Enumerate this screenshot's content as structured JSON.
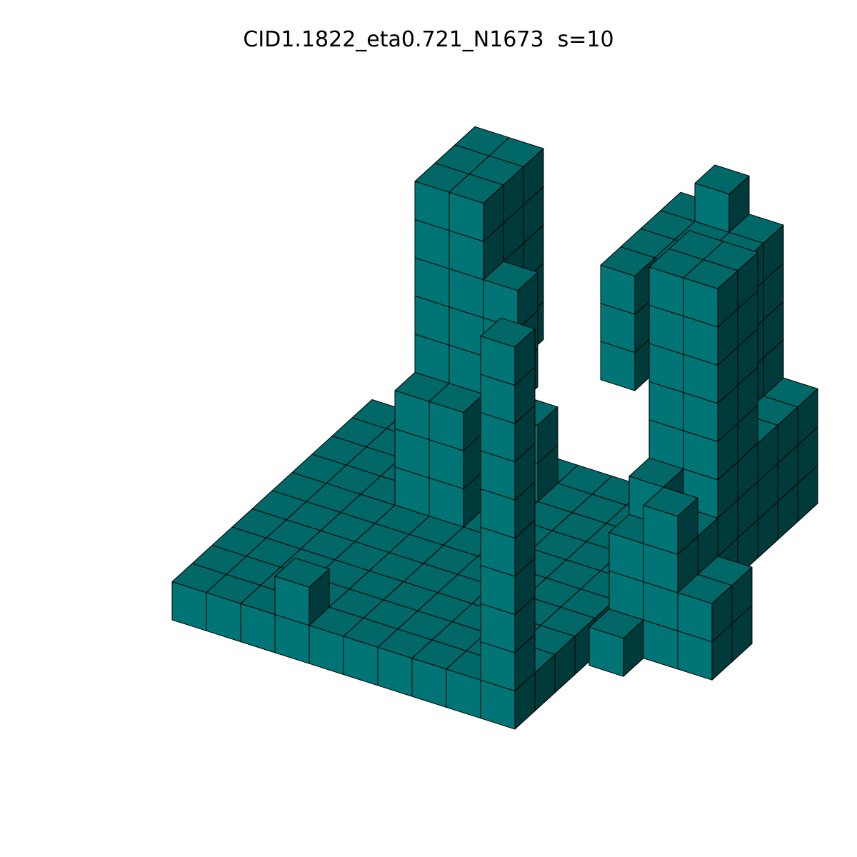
{
  "figure": {
    "title": "CID1.1822_eta0.721_N1673  s=10"
  },
  "colors": {
    "top_face": "#016767",
    "front_face": "#017575",
    "side_face": "#003a3a",
    "edge": "#000000",
    "background": "#ffffff"
  }
}
